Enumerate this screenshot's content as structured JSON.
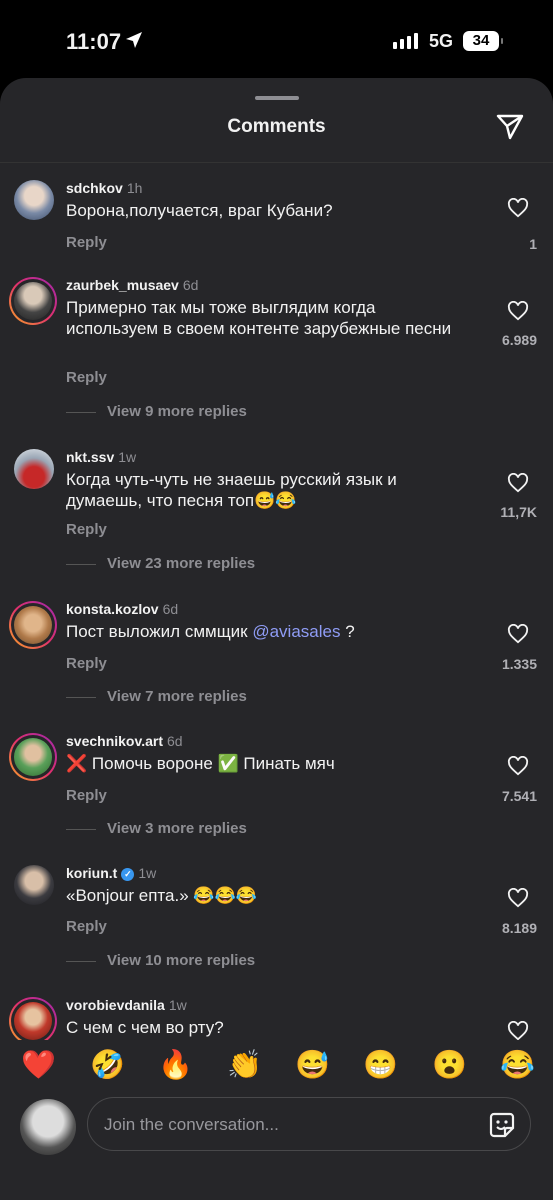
{
  "status_bar": {
    "time": "11:07",
    "network": "5G",
    "battery": "34"
  },
  "sheet": {
    "title": "Comments"
  },
  "comments": [
    {
      "username": "sdchkov",
      "age": "1h",
      "text": "Ворона,получается, враг Кубани?",
      "reply": "Reply",
      "likes": "1",
      "more_replies": ""
    },
    {
      "username": "zaurbek_musaev",
      "age": "6d",
      "text": "Примерно так мы тоже выглядим когда используем в своем контенте зарубежные песни",
      "reply": "Reply",
      "likes": "6.989",
      "more_replies": "View 9 more replies"
    },
    {
      "username": "nkt.ssv",
      "age": "1w",
      "text": "Когда чуть-чуть не знаешь русский язык и думаешь, что песня топ😅😂",
      "reply": "Reply",
      "likes": "11,7K",
      "more_replies": "View 23 more replies"
    },
    {
      "username": "konsta.kozlov",
      "age": "6d",
      "text_before": "Пост выложил сммщик ",
      "mention": "@aviasales",
      "text_after": " ?",
      "reply": "Reply",
      "likes": "1.335",
      "more_replies": "View 7 more replies"
    },
    {
      "username": "svechnikov.art",
      "age": "6d",
      "text": "❌ Помочь вороне ✅ Пинать мяч",
      "reply": "Reply",
      "likes": "7.541",
      "more_replies": "View 3 more replies"
    },
    {
      "username": "koriun.t",
      "age": "1w",
      "text": "«Bonjour епта.» 😂😂😂",
      "reply": "Reply",
      "likes": "8.189",
      "more_replies": "View 10 more replies"
    },
    {
      "username": "vorobievdanila",
      "age": "1w",
      "text": "С чем с чем во рту?",
      "reply": "",
      "likes": "",
      "more_replies": ""
    }
  ],
  "reactions": [
    "❤️",
    "🤣",
    "🔥",
    "👏",
    "😅",
    "😁",
    "😮",
    "😂"
  ],
  "composer": {
    "placeholder": "Join the conversation..."
  },
  "colors": {
    "background": "#262629",
    "mention": "#8f9cf5",
    "secondary_text": "#8e8e93"
  }
}
